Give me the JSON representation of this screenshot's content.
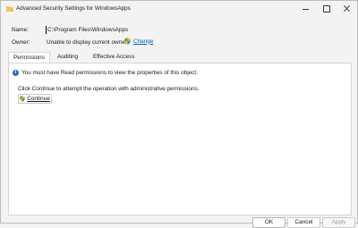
{
  "window": {
    "title": "Advanced Security Settings for WindowsApps"
  },
  "fields": {
    "name_label": "Name:",
    "name_value": "C:\\Program Files\\WindowsApps",
    "owner_label": "Owner:",
    "owner_value": "Unable to display current owner.",
    "change_link": "Change"
  },
  "tabs": [
    {
      "label": "Permissions",
      "active": true
    },
    {
      "label": "Auditing",
      "active": false
    },
    {
      "label": "Effective Access",
      "active": false
    }
  ],
  "panel": {
    "info_message": "You must have Read permissions to view the properties of this object.",
    "continue_message": "Click Continue to attempt the operation with administrative permissions.",
    "continue_button": "Continue"
  },
  "buttons": {
    "ok": "OK",
    "cancel": "Cancel",
    "apply": "Apply"
  },
  "icons": {
    "title": "folder-icon",
    "shield": "uac-shield-icon",
    "info": "info-icon"
  }
}
